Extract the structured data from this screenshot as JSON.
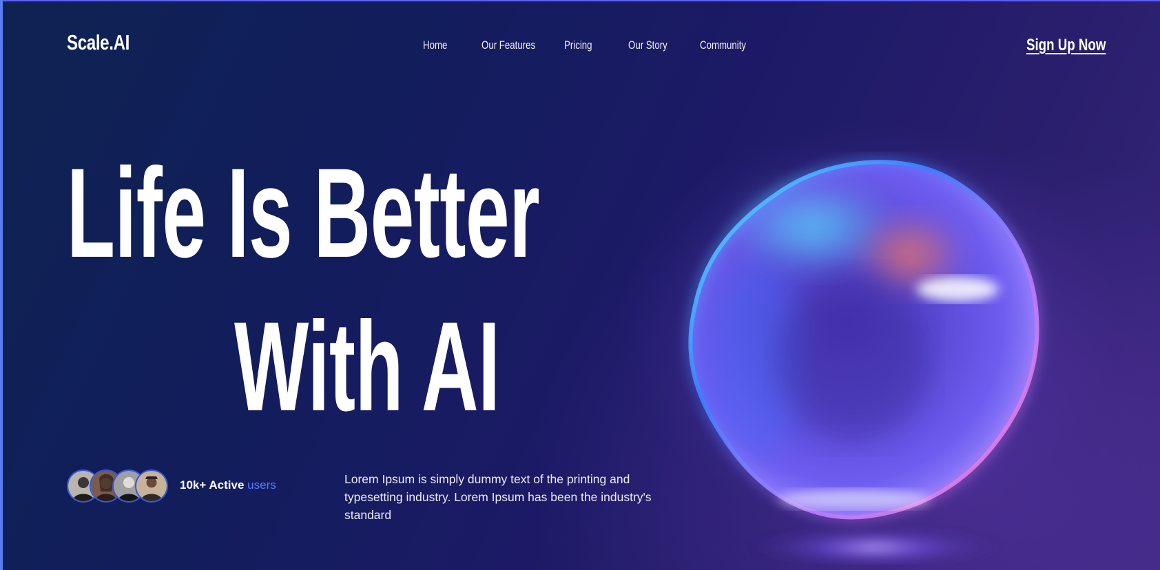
{
  "header": {
    "logo": "Scale.AI",
    "nav": [
      {
        "label": "Home"
      },
      {
        "label": "Our Features"
      },
      {
        "label": "Pricing"
      },
      {
        "label": "Our Story"
      },
      {
        "label": "Community"
      }
    ],
    "cta_label": "Sign Up Now"
  },
  "hero": {
    "title_line1": "Life Is Better",
    "title_line2": "With AI",
    "users": {
      "count_text": "10k+ Active",
      "highlight": "users"
    },
    "description": "Lorem Ipsum is simply dummy text of the printing and typesetting industry. Lorem Ipsum has been the industry's standard",
    "avatar_icons": [
      "user-avatar-1",
      "user-avatar-2",
      "user-avatar-3",
      "user-avatar-4"
    ]
  },
  "colors": {
    "accent": "#4f7fff",
    "background_dark": "#121d5c",
    "background_purple": "#3a2880"
  }
}
